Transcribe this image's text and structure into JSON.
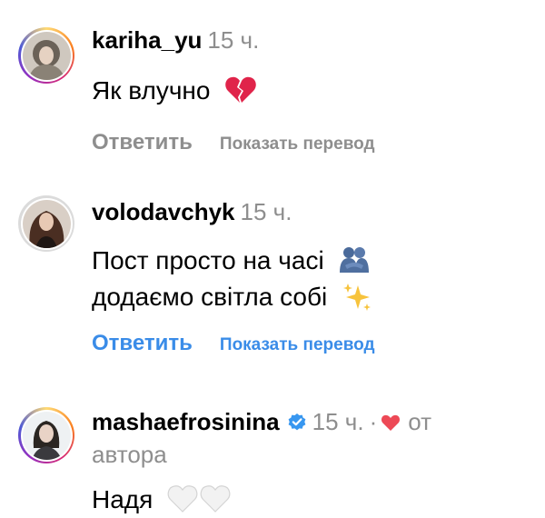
{
  "comments": [
    {
      "username": "kariha_yu",
      "time": "15 ч.",
      "text_lines": [
        "Як влучно"
      ],
      "emoji": "broken-heart",
      "reply_label": "Ответить",
      "translate_label": "Показать перевод"
    },
    {
      "username": "volodavchyk",
      "time": "15 ч.",
      "text_lines": [
        "Пост просто на часі",
        "додаємо світла собі"
      ],
      "emoji": [
        "people-hugging",
        "sparkles"
      ],
      "reply_label": "Ответить",
      "translate_label": "Показать перевод"
    },
    {
      "username": "mashaefrosinina",
      "verified": true,
      "time": "15 ч.",
      "separator": "·",
      "liked_by_author_label": "от",
      "liked_by_author_label2": "автора",
      "text_lines": [
        "Надя"
      ],
      "emoji": [
        "white-heart",
        "white-heart"
      ]
    }
  ],
  "colors": {
    "link_blue": "#3a8ce8",
    "muted_grey": "#8e8e8e",
    "heart_red": "#ed4956",
    "verified_blue": "#3897f0"
  }
}
